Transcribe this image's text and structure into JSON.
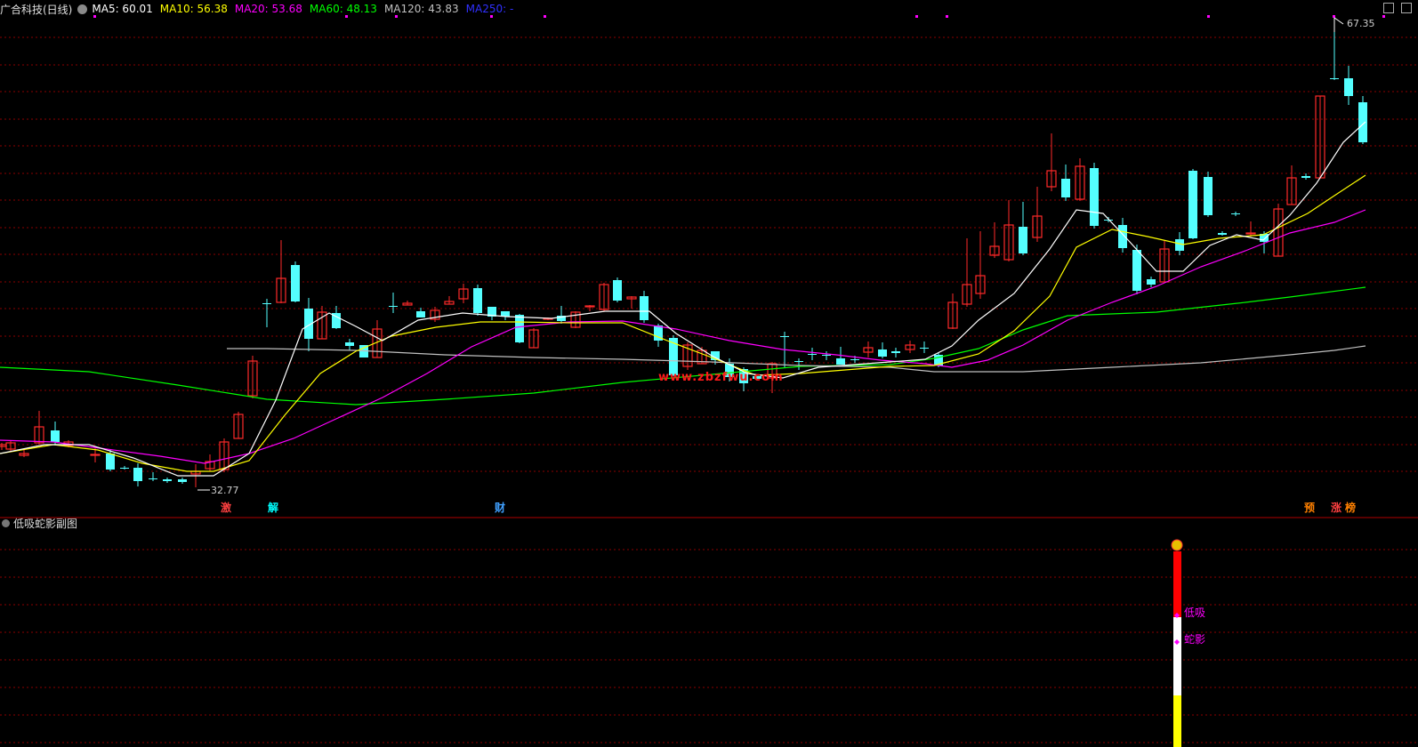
{
  "header": {
    "title": "广合科技(日线)",
    "ma5": "MA5: 60.01",
    "ma10": "MA10: 56.38",
    "ma20": "MA20: 53.68",
    "ma60": "MA60: 48.13",
    "ma120": "MA120: 43.83",
    "ma250": "MA250: -"
  },
  "colors": {
    "up": "#ff2a2a",
    "down": "#54ffff",
    "ma5": "#ffffff",
    "ma10": "#ffff00",
    "ma20": "#ff00ff",
    "ma60": "#00ff00",
    "ma120": "#c0c0c0",
    "ma250": "#3030ff",
    "grid": "#8b0000"
  },
  "price": {
    "high_label": "67.35",
    "low_label": "32.77",
    "watermark": "www.zbzfwu.com"
  },
  "signals": [
    "激",
    "解",
    "财",
    "预",
    "涨",
    "榜"
  ],
  "lower": {
    "title": "低吸蛇影副图",
    "label_a": "低吸",
    "label_b": "蛇影",
    "marker_icon": "money-bag-icon"
  }
}
